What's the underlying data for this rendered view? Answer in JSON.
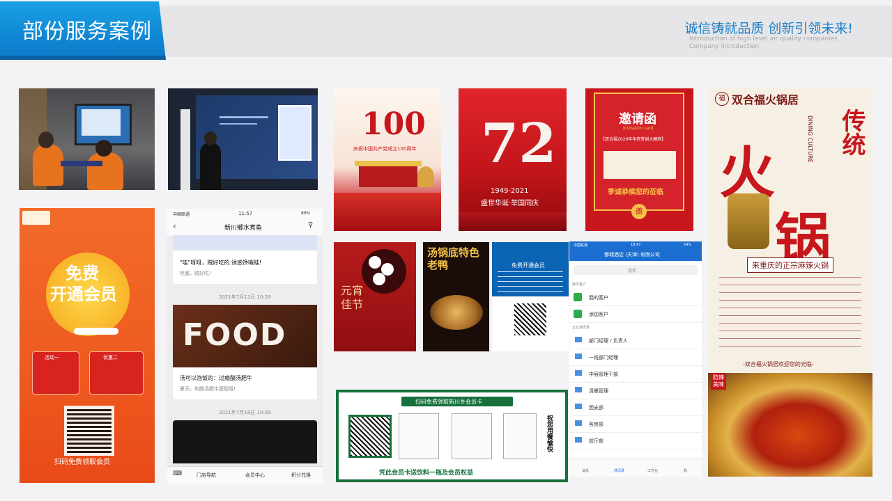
{
  "header": {
    "title": "部份服务案例",
    "slogan": "诚信铸就品质 创新引领未来!",
    "slogan_en_1": "Introduction of high level air quality companies",
    "slogan_en_2": "Company introduction"
  },
  "posters": {
    "p100": {
      "num": "100",
      "sub": "庆祝中国共产党成立100周年"
    },
    "p72": {
      "num": "72",
      "years": "1949-2021",
      "tag": "盛世华诞·举国同庆"
    },
    "invite": {
      "title": "邀请函",
      "en": "Invitation card",
      "line": "【双合福2020年年终答谢大酬宾】",
      "foot": "季诚恭候您的莅临",
      "seal": "邀"
    },
    "yuanxiao": {
      "text": "元宵佳节"
    },
    "duck": {
      "text": "汤锅底特色老鸭"
    },
    "member_small": {
      "title": "免费开通会员"
    },
    "hotpot": {
      "brand": "双合福火锅居",
      "big1": "火",
      "big2": "锅",
      "side": "传统",
      "en": "DINING CULTURE",
      "motto": "来重庆的正宗麻辣火锅",
      "foot": "-双合福火锅居欢迎您的光临-",
      "tag": "防辣美味"
    },
    "member_big": {
      "title1": "免费",
      "title2": "开通会员",
      "act1": "活动一",
      "act1_desc": "激活卷子赠会员卡 送饮料一瓶",
      "act2": "优惠二",
      "act2_desc": "会员消费享优惠",
      "footer": "扫码免费领取会员"
    },
    "banner": {
      "title": "扫码免费领取新川乡会员卡",
      "side": "祝您用餐愉快",
      "foot": "凭此会员卡送饮料一瓶及会员权益"
    }
  },
  "phone1": {
    "status_left": "中国联通",
    "time": "11:57",
    "battery": "89%",
    "title": "新川鄉水煮鱼",
    "msg1": "\"哇\"呀呀，贼好吃的:诱惑馋嘴蛙!",
    "msg1_sub": "哇塞，贼好吃!",
    "date1": "2021年7月11日 10:28",
    "food": "FOOD",
    "msg2": "汤可以泡饭的：过瘾酸汤肥牛",
    "msg2_sub": "夏天，和酸汤肥牛更配哦!",
    "date2": "2021年7月18日 10:09",
    "nav": [
      "门店导航",
      "会员中心",
      "积分兑换"
    ]
  },
  "phone2": {
    "status_left": "中国联通",
    "time": "18:47",
    "battery": "54%",
    "title": "都城酒店 (天津) 有限公司",
    "search": "搜索",
    "section1": "我的客户",
    "items1": [
      "我的客户",
      "添加客户"
    ],
    "section2": "企业通讯录",
    "items2": [
      "部门经理 / 负责人",
      "一线部门经理",
      "中层管理干部",
      "清晨管理",
      "团支部",
      "客房部",
      "前厅部"
    ],
    "tabs": [
      "消息",
      "通讯录",
      "工作台",
      "我"
    ]
  },
  "colors": {
    "accent": "#0a78c8",
    "red": "#c8161d",
    "gold": "#f5c44a"
  }
}
